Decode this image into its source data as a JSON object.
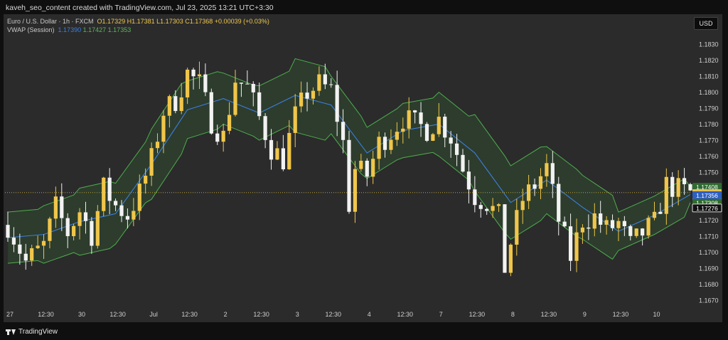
{
  "header": {
    "caption": "kaveh_seo_content created with TradingView.com, Jul 23, 2025 13:21 UTC+3:30"
  },
  "legend": {
    "symbol": "Euro / U.S. Dollar · 1h · FXCM",
    "open": "O1.17329",
    "high": "H1.17381",
    "low": "L1.17303",
    "close": "C1.17368",
    "change": "+0.00039 (+0.03%)",
    "vwap_label": "VWAP (Session)",
    "vwap_v1": "1.17390",
    "vwap_v2": "1.17427",
    "vwap_v3": "1.17353"
  },
  "currency_button": "USD",
  "footer": {
    "brand": "TradingView"
  },
  "colors": {
    "background": "#2b2b2b",
    "bull": "#f0c64a",
    "bear": "#f2f2f2",
    "vwap": "#3c7fe0",
    "band": "#4fae4f",
    "band_fill": "#2f4a30",
    "axis_text": "#d0d0d0",
    "price_line": "#b9a23a"
  },
  "chart_data": {
    "type": "candlestick",
    "symbol": "EUR/USD",
    "timeframe": "1h",
    "y_ticks": [
      1.183,
      1.182,
      1.181,
      1.18,
      1.179,
      1.178,
      1.177,
      1.176,
      1.175,
      1.174,
      1.173,
      1.172,
      1.171,
      1.17,
      1.169,
      1.168,
      1.167
    ],
    "ylim": [
      1.1665,
      1.1839
    ],
    "x_ticks": [
      "27",
      "12:30",
      "30",
      "12:30",
      "Jul",
      "12:30",
      "2",
      "12:30",
      "3",
      "12:30",
      "4",
      "12:30",
      "7",
      "12:30",
      "8",
      "12:30",
      "9",
      "12:30",
      "10"
    ],
    "x_tick_index": [
      0,
      6,
      12,
      18,
      24,
      30,
      36,
      42,
      48,
      54,
      60,
      66,
      72,
      78,
      84,
      90,
      96,
      102,
      108
    ],
    "candle_count": 115,
    "anchors": [
      [
        0,
        1.1717
      ],
      [
        3,
        1.1694
      ],
      [
        6,
        1.1704
      ],
      [
        8,
        1.1728
      ],
      [
        10,
        1.1712
      ],
      [
        12,
        1.1726
      ],
      [
        14,
        1.1711
      ],
      [
        16,
        1.174
      ],
      [
        18,
        1.1729
      ],
      [
        20,
        1.1723
      ],
      [
        22,
        1.1737
      ],
      [
        24,
        1.1758
      ],
      [
        26,
        1.1788
      ],
      [
        28,
        1.1795
      ],
      [
        30,
        1.1812
      ],
      [
        32,
        1.1805
      ],
      [
        34,
        1.1782
      ],
      [
        36,
        1.1772
      ],
      [
        38,
        1.1808
      ],
      [
        40,
        1.1803
      ],
      [
        42,
        1.1784
      ],
      [
        44,
        1.1765
      ],
      [
        46,
        1.1758
      ],
      [
        48,
        1.1785
      ],
      [
        50,
        1.18
      ],
      [
        52,
        1.1805
      ],
      [
        54,
        1.1801
      ],
      [
        56,
        1.1768
      ],
      [
        57,
        1.173
      ],
      [
        58,
        1.1752
      ],
      [
        60,
        1.1748
      ],
      [
        62,
        1.1768
      ],
      [
        64,
        1.1775
      ],
      [
        66,
        1.1784
      ],
      [
        68,
        1.178
      ],
      [
        70,
        1.1777
      ],
      [
        72,
        1.1783
      ],
      [
        74,
        1.1772
      ],
      [
        76,
        1.1752
      ],
      [
        78,
        1.1735
      ],
      [
        80,
        1.1731
      ],
      [
        82,
        1.1722
      ],
      [
        83,
        1.169
      ],
      [
        84,
        1.1706
      ],
      [
        86,
        1.1733
      ],
      [
        88,
        1.1742
      ],
      [
        90,
        1.1753
      ],
      [
        92,
        1.172
      ],
      [
        94,
        1.1697
      ],
      [
        96,
        1.172
      ],
      [
        98,
        1.1722
      ],
      [
        100,
        1.1714
      ],
      [
        102,
        1.1718
      ],
      [
        104,
        1.1704
      ],
      [
        106,
        1.1712
      ],
      [
        108,
        1.1718
      ],
      [
        110,
        1.1742
      ],
      [
        112,
        1.1739
      ],
      [
        114,
        1.1737
      ]
    ],
    "vwap_anchors": [
      [
        0,
        1.1709
      ],
      [
        6,
        1.1711
      ],
      [
        12,
        1.1719
      ],
      [
        18,
        1.1724
      ],
      [
        24,
        1.1755
      ],
      [
        30,
        1.1789
      ],
      [
        36,
        1.1796
      ],
      [
        42,
        1.1787
      ],
      [
        48,
        1.1798
      ],
      [
        54,
        1.1792
      ],
      [
        60,
        1.1762
      ],
      [
        66,
        1.1776
      ],
      [
        72,
        1.178
      ],
      [
        78,
        1.1762
      ],
      [
        84,
        1.1731
      ],
      [
        90,
        1.1745
      ],
      [
        96,
        1.1728
      ],
      [
        102,
        1.1713
      ],
      [
        108,
        1.1723
      ],
      [
        114,
        1.1736
      ]
    ],
    "band_width": [
      0.0016,
      0.0018,
      0.0021,
      0.0019,
      0.0022,
      0.0018,
      0.0016,
      0.0017,
      0.0023,
      0.0018,
      0.0016,
      0.0017,
      0.002,
      0.0024,
      0.0023,
      0.0021,
      0.002,
      0.0012,
      0.0012,
      0.0005
    ],
    "current_price_line": 1.17372,
    "axis_labels": [
      {
        "value": 1.17408,
        "text": "1.17408",
        "bg": "#2f6b2f",
        "fg": "#ffffff"
      },
      {
        "value": 1.17368,
        "text": "1.17368",
        "sub": "08:05",
        "bg": "#f0c64a",
        "fg": "#000000"
      },
      {
        "value": 1.17356,
        "text": "1.17356",
        "bg": "#2f5fc0",
        "fg": "#ffffff"
      },
      {
        "value": 1.17308,
        "text": "1.17308",
        "bg": "#2f6b2f",
        "fg": "#ffffff"
      },
      {
        "value": 1.17276,
        "text": "1.17276",
        "bg": "#111111",
        "fg": "#ffffff",
        "border": "#dcdcdc"
      }
    ]
  }
}
